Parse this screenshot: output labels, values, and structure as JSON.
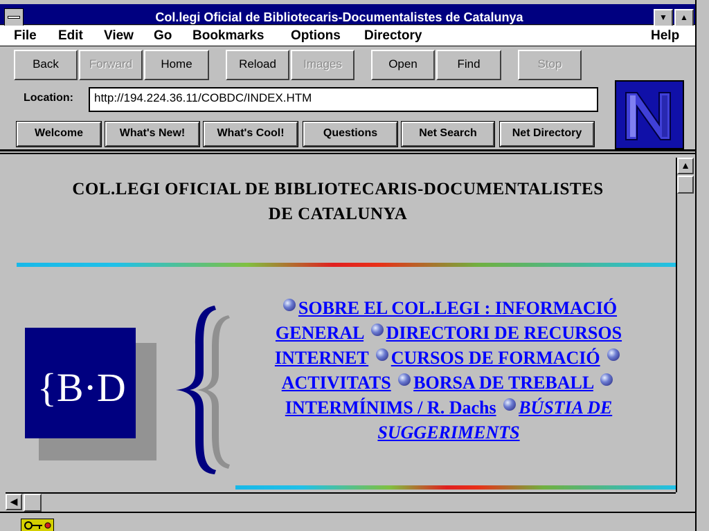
{
  "window": {
    "title": "Col.legi Oficial de Bibliotecaris-Documentalistes de Catalunya",
    "minimize_glyph": "▼",
    "maximize_glyph": "▲"
  },
  "menu": {
    "file": "File",
    "edit": "Edit",
    "view": "View",
    "go": "Go",
    "bookmarks": "Bookmarks",
    "options": "Options",
    "directory": "Directory",
    "help": "Help"
  },
  "toolbar": {
    "back": "Back",
    "forward": "Forward",
    "home": "Home",
    "reload": "Reload",
    "images": "Images",
    "open": "Open",
    "find": "Find",
    "stop": "Stop"
  },
  "location": {
    "label": "Location:",
    "value": "http://194.224.36.11/COBDC/INDEX.HTM"
  },
  "directory_buttons": {
    "welcome": "Welcome",
    "whats_new": "What's New!",
    "whats_cool": "What's Cool!",
    "questions": "Questions",
    "net_search": "Net Search",
    "net_directory": "Net Directory"
  },
  "logo": {
    "letter": "N"
  },
  "page": {
    "heading_line1": "COL.LEGI OFICIAL DE BIBLIOTECARIS-DOCUMENTALISTES",
    "heading_line2": "DE CATALUNYA",
    "bd_logo_text": "{B·D",
    "links": {
      "sobre": "SOBRE EL COL.LEGI : INFORMACIÓ GENERAL",
      "directori": "DIRECTORI DE RECURSOS INTERNET",
      "cursos": "CURSOS DE FORMACIÓ",
      "activitats": "ACTIVITATS",
      "borsa": "BORSA DE TREBALL",
      "interminims": "INTERMÍNIMS / R. Dachs",
      "bustia": "BÚSTIA DE SUGGERIMENTS"
    }
  },
  "scrollbar": {
    "up_glyph": "▲",
    "left_glyph": "◀"
  },
  "colors": {
    "title_bar": "#000080",
    "link": "#0000ff",
    "chrome": "#c0c0c0",
    "logo_blue": "#000080"
  }
}
